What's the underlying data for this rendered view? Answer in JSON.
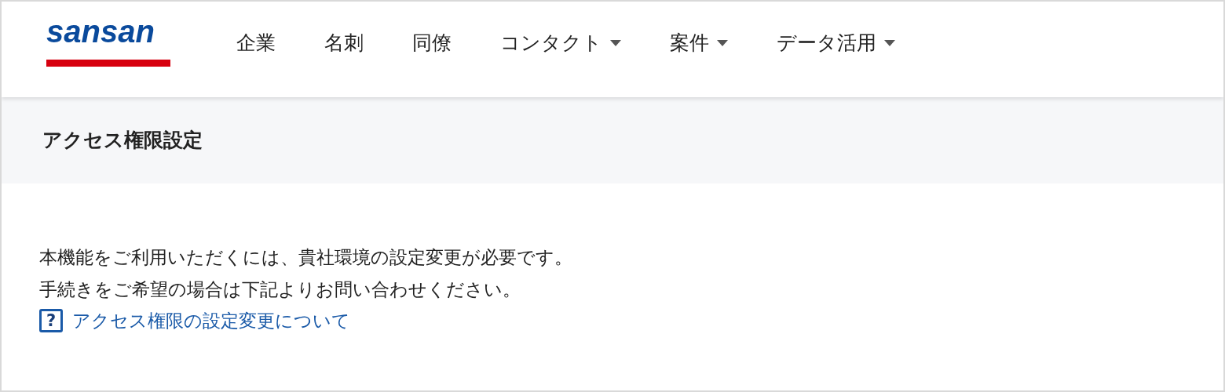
{
  "header": {
    "logo": "sansan",
    "nav": [
      {
        "label": "企業",
        "dropdown": false
      },
      {
        "label": "名刺",
        "dropdown": false
      },
      {
        "label": "同僚",
        "dropdown": false
      },
      {
        "label": "コンタクト",
        "dropdown": true
      },
      {
        "label": "案件",
        "dropdown": true
      },
      {
        "label": "データ活用",
        "dropdown": true
      }
    ]
  },
  "page_title": "アクセス権限設定",
  "body": {
    "lines": [
      "本機能をご利用いただくには、貴社環境の設定変更が必要です。",
      "手続きをご希望の場合は下記よりお問い合わせください。"
    ],
    "help_link": {
      "icon": "?",
      "label": "アクセス権限の設定変更について"
    }
  }
}
